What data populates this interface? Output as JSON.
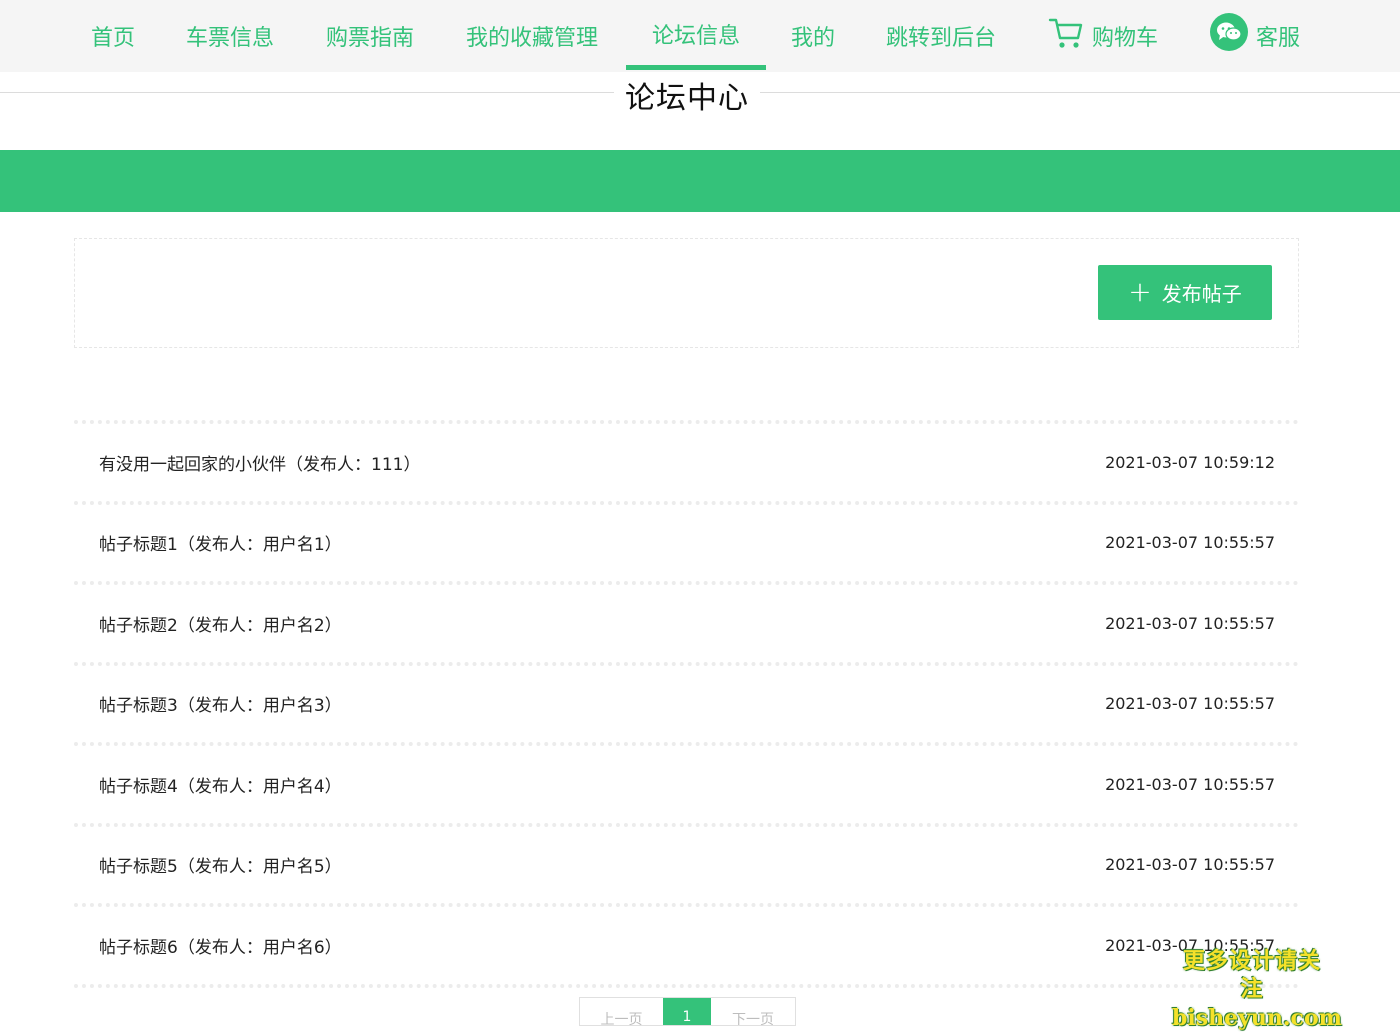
{
  "nav": {
    "items": [
      {
        "label": "首页"
      },
      {
        "label": "车票信息"
      },
      {
        "label": "购票指南"
      },
      {
        "label": "我的收藏管理"
      },
      {
        "label": "论坛信息"
      },
      {
        "label": "我的"
      },
      {
        "label": "跳转到后台"
      },
      {
        "label": "购物车",
        "icon": "cart-icon"
      },
      {
        "label": "客服",
        "icon": "wechat-icon"
      }
    ],
    "active_index": 4
  },
  "page": {
    "title": "论坛中心"
  },
  "actions": {
    "publish_label": "发布帖子"
  },
  "posts": [
    {
      "title": "有没用一起回家的小伙伴（发布人：111）",
      "time": "2021-03-07 10:59:12"
    },
    {
      "title": "帖子标题1（发布人：用户名1）",
      "time": "2021-03-07 10:55:57"
    },
    {
      "title": "帖子标题2（发布人：用户名2）",
      "time": "2021-03-07 10:55:57"
    },
    {
      "title": "帖子标题3（发布人：用户名3）",
      "time": "2021-03-07 10:55:57"
    },
    {
      "title": "帖子标题4（发布人：用户名4）",
      "time": "2021-03-07 10:55:57"
    },
    {
      "title": "帖子标题5（发布人：用户名5）",
      "time": "2021-03-07 10:55:57"
    },
    {
      "title": "帖子标题6（发布人：用户名6）",
      "time": "2021-03-07 10:55:57"
    }
  ],
  "pagination": {
    "prev_label": "上一页",
    "current_page": "1",
    "next_label": "下一页"
  },
  "watermark": {
    "line1": "更多设计请关注",
    "line2": "bisheyun.com"
  },
  "colors": {
    "accent": "#34c27a",
    "nav_bg": "#f5f5f5"
  }
}
